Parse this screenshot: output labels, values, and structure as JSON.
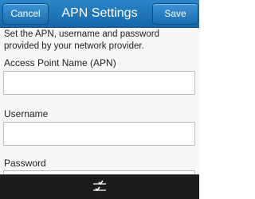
{
  "header": {
    "cancel_label": "Cancel",
    "title": "APN Settings",
    "save_label": "Save"
  },
  "description": "Set the APN, username and password provided by your network provider.",
  "fields": [
    {
      "label": "Access Point Name (APN)",
      "value": ""
    },
    {
      "label": "Username",
      "value": ""
    },
    {
      "label": "Password",
      "value": ""
    }
  ],
  "icons": {
    "bottom_menu": "menu-sliders-icon"
  },
  "colors": {
    "titlebar": "#1e74b8",
    "bottombar": "#1c1c1c"
  }
}
